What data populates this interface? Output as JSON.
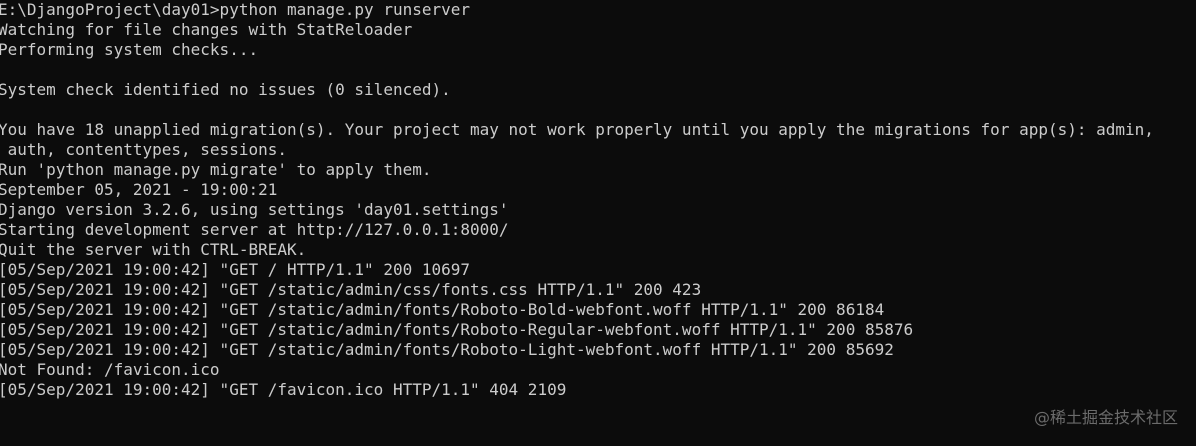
{
  "terminal": {
    "lines": [
      "E:\\DjangoProject\\day01>python manage.py runserver",
      "Watching for file changes with StatReloader",
      "Performing system checks...",
      "",
      "System check identified no issues (0 silenced).",
      "",
      "You have 18 unapplied migration(s). Your project may not work properly until you apply the migrations for app(s): admin,",
      " auth, contenttypes, sessions.",
      "Run 'python manage.py migrate' to apply them.",
      "September 05, 2021 - 19:00:21",
      "Django version 3.2.6, using settings 'day01.settings'",
      "Starting development server at http://127.0.0.1:8000/",
      "Quit the server with CTRL-BREAK.",
      "[05/Sep/2021 19:00:42] \"GET / HTTP/1.1\" 200 10697",
      "[05/Sep/2021 19:00:42] \"GET /static/admin/css/fonts.css HTTP/1.1\" 200 423",
      "[05/Sep/2021 19:00:42] \"GET /static/admin/fonts/Roboto-Bold-webfont.woff HTTP/1.1\" 200 86184",
      "[05/Sep/2021 19:00:42] \"GET /static/admin/fonts/Roboto-Regular-webfont.woff HTTP/1.1\" 200 85876",
      "[05/Sep/2021 19:00:42] \"GET /static/admin/fonts/Roboto-Light-webfont.woff HTTP/1.1\" 200 85692",
      "Not Found: /favicon.ico",
      "[05/Sep/2021 19:00:42] \"GET /favicon.ico HTTP/1.1\" 404 2109"
    ]
  },
  "watermark": {
    "text": "@稀土掘金技术社区"
  },
  "colors": {
    "background": "#0c0c0c",
    "foreground": "#cccccc",
    "watermark": "#6b6b6b"
  }
}
